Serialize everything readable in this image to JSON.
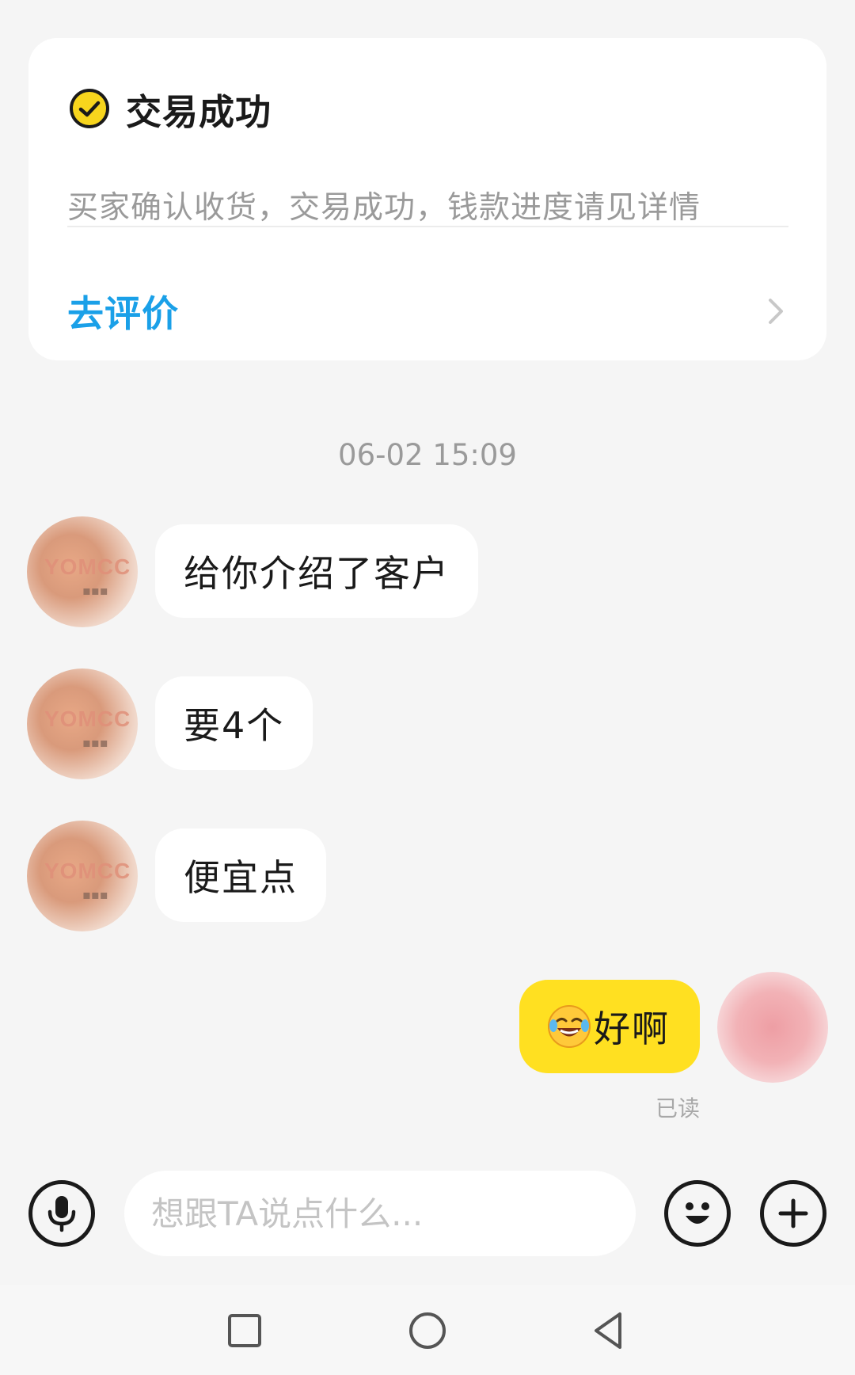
{
  "order_card": {
    "title": "交易成功",
    "subtitle": "买家确认收货，交易成功，钱款进度请见详情",
    "review_label": "去评价",
    "status_icon": "check-circle-icon",
    "accent_color": "#1aa0e8",
    "status_color": "#f7d51d"
  },
  "chat": {
    "timestamp": "06-02 15:09",
    "messages": [
      {
        "side": "left",
        "text": "给你介绍了客户"
      },
      {
        "side": "left",
        "text": "要4个"
      },
      {
        "side": "left",
        "text": "便宜点"
      },
      {
        "side": "right",
        "emoji": "laughing-crying-emoji",
        "text": "好啊",
        "status": "已读"
      }
    ],
    "my_bubble_color": "#ffe021"
  },
  "input_bar": {
    "placeholder": "想跟TA说点什么...",
    "voice_icon": "microphone-icon",
    "emoji_icon": "smiley-icon",
    "more_icon": "plus-icon"
  },
  "navbar": {
    "icons": [
      "square-icon",
      "circle-icon",
      "triangle-back-icon"
    ]
  }
}
